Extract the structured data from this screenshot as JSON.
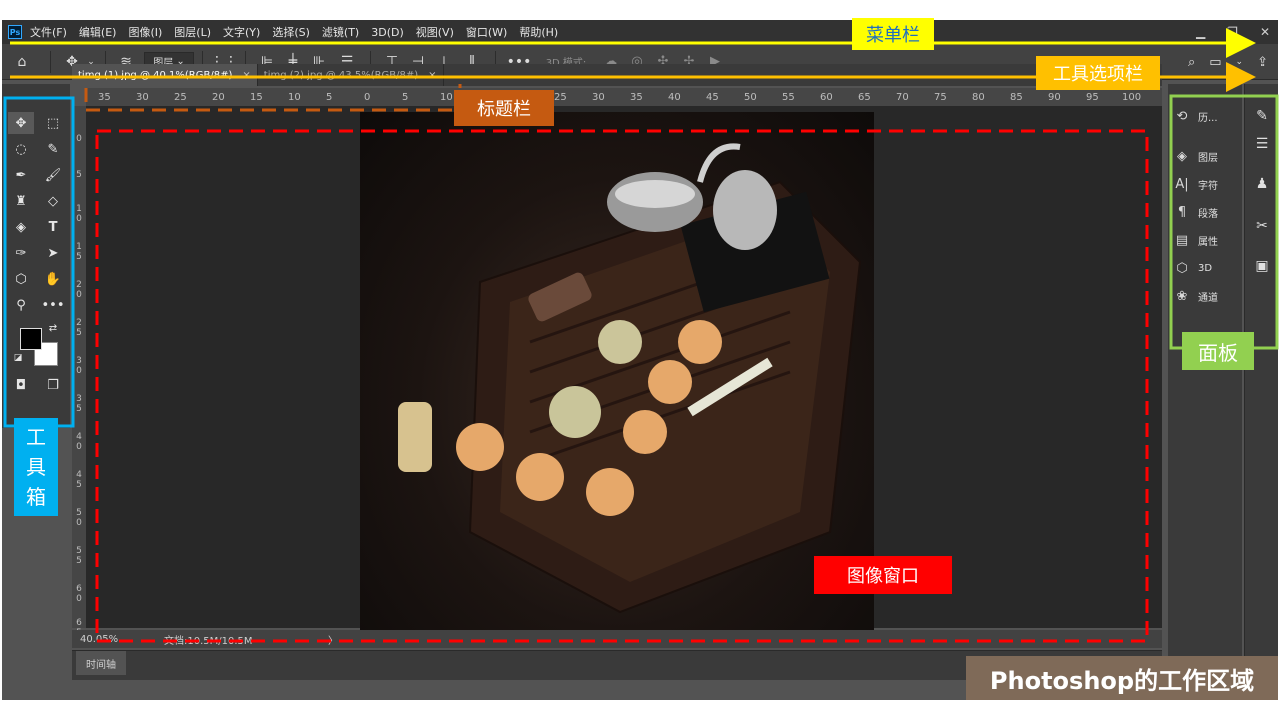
{
  "app": {
    "logo": "Ps",
    "menu": [
      "文件(F)",
      "编辑(E)",
      "图像(I)",
      "图层(L)",
      "文字(Y)",
      "选择(S)",
      "滤镜(T)",
      "3D(D)",
      "视图(V)",
      "窗口(W)",
      "帮助(H)"
    ],
    "window_controls": [
      "minimize-icon",
      "restore-icon",
      "close-icon"
    ]
  },
  "options_bar": {
    "layer_select": "图层",
    "mode_label": "3D 模式:",
    "icons": [
      "home-icon",
      "move-icon",
      "auto-select-icon",
      "transform-icon",
      "align-left-icon",
      "align-center-icon",
      "align-right-icon",
      "distribute-icon",
      "align-top-icon",
      "align-middle-icon",
      "align-bottom-icon",
      "distribute-v-icon",
      "more-icon",
      "3d-orbit-icon",
      "3d-roll-icon",
      "3d-pan-icon",
      "3d-slide-icon",
      "3d-camera-icon",
      "search-icon",
      "workspace-icon",
      "share-icon"
    ]
  },
  "tabs": [
    {
      "label": "timg (1).jpg @ 40.1%(RGB/8#)",
      "close": "×",
      "active": true
    },
    {
      "label": "timg (2).jpg @ 43.5%(RGB/8#)",
      "close": "×",
      "active": false
    }
  ],
  "ruler": {
    "top": [
      "35",
      "30",
      "25",
      "20",
      "15",
      "10",
      "5",
      "0",
      "5",
      "10",
      "15",
      "20",
      "25",
      "30",
      "35",
      "40",
      "45",
      "50",
      "55",
      "60",
      "65",
      "70",
      "75",
      "80",
      "85",
      "90",
      "95",
      "100"
    ],
    "left": [
      "0",
      "5",
      "1 0",
      "1 5",
      "2 0",
      "2 5",
      "3 0",
      "3 5",
      "4 0",
      "4 5",
      "5 0",
      "5 5",
      "6 0",
      "6 5"
    ]
  },
  "status": {
    "zoom": "40.05%",
    "doc": "文档:10.5M/10.5M",
    "arrow": "〉"
  },
  "timeline": {
    "label": "时间轴"
  },
  "panels": {
    "items": [
      {
        "icon": "history-icon",
        "label": "历..."
      },
      {
        "icon": "layers-icon",
        "label": "图层"
      },
      {
        "icon": "character-icon",
        "label": "字符"
      },
      {
        "icon": "paragraph-icon",
        "label": "段落"
      },
      {
        "icon": "properties-icon",
        "label": "属性"
      },
      {
        "icon": "3d-icon",
        "label": "3D"
      },
      {
        "icon": "channels-icon",
        "label": "通道"
      }
    ],
    "side_icons": [
      "brush-settings-icon",
      "adjustments-icon",
      "clone-source-icon",
      "tool-presets-icon",
      "libraries-icon"
    ]
  },
  "annotations": {
    "menubar": {
      "label": "菜单栏",
      "color": "#ffff00"
    },
    "optionsbar": {
      "label": "工具选项栏",
      "color": "#ffc000"
    },
    "titlebar": {
      "label": "标题栏",
      "color": "#c55a11"
    },
    "toolbox": {
      "label": "工\n具\n箱",
      "color": "#00b0f0"
    },
    "panels": {
      "label": "面板",
      "color": "#92d050"
    },
    "imagewindow": {
      "label": "图像窗口",
      "color": "#ff0000"
    }
  },
  "slide_title": "Photoshop的工作区域"
}
